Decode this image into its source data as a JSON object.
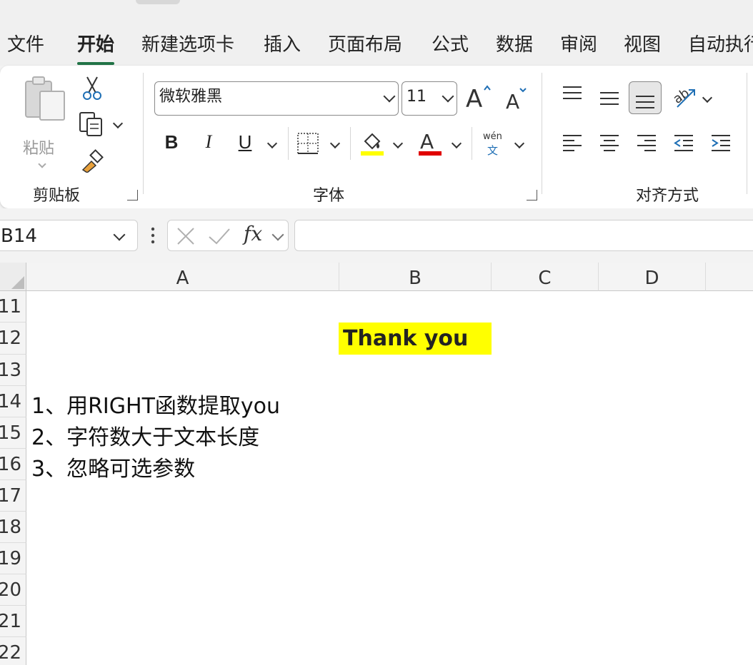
{
  "menu": {
    "tabs": [
      "文件",
      "开始",
      "新建选项卡",
      "插入",
      "页面布局",
      "公式",
      "数据",
      "审阅",
      "视图",
      "自动执行"
    ],
    "active": "开始"
  },
  "clipboard": {
    "paste_label": "粘贴",
    "group_label": "剪贴板"
  },
  "font": {
    "name": "微软雅黑",
    "size": "11",
    "bold": "B",
    "italic": "I",
    "underline": "U",
    "phonetic_top": "wén",
    "phonetic_bottom": "文",
    "group_label": "字体",
    "fill_color": "#ffff00",
    "font_color": "#e00000"
  },
  "alignment": {
    "group_label": "对齐方式"
  },
  "formula_bar": {
    "name_box": "B14",
    "fx": "fx",
    "formula": ""
  },
  "sheet": {
    "columns": [
      "A",
      "B",
      "C",
      "D"
    ],
    "rows": [
      "11",
      "12",
      "13",
      "14",
      "15",
      "16",
      "17",
      "18",
      "19",
      "20",
      "21",
      "22"
    ],
    "cells": {
      "B12": "Thank you",
      "A14": "1、用RIGHT函数提取you",
      "A15": "2、字符数大于文本长度",
      "A16": "3、忽略可选参数"
    }
  }
}
